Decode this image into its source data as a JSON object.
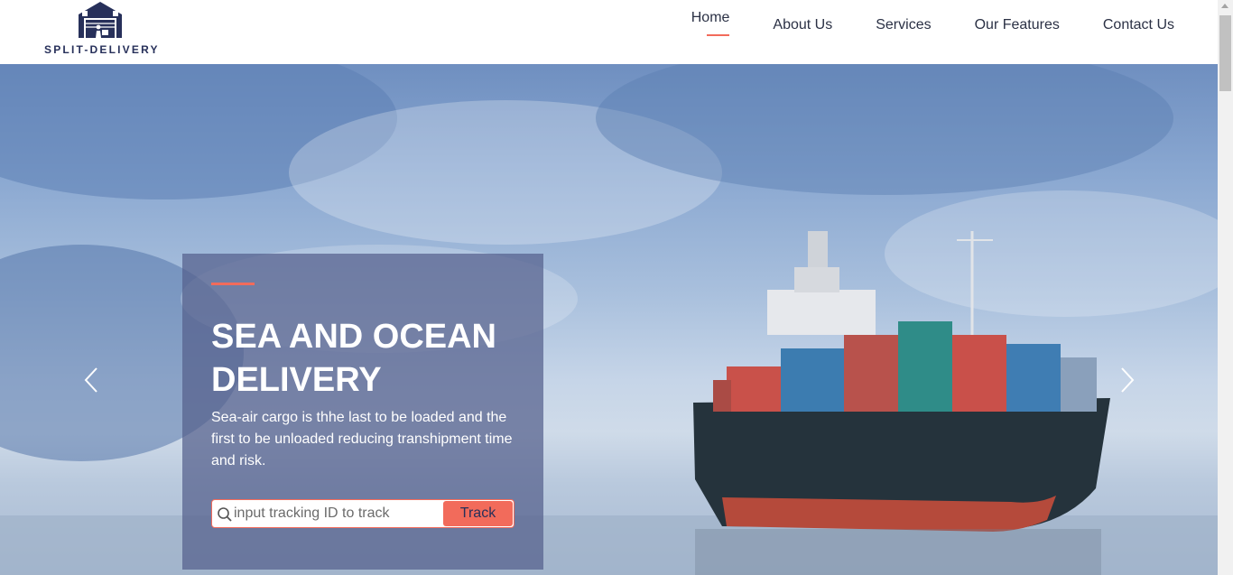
{
  "brand": {
    "name": "SPLIT-DELIVERY"
  },
  "nav": {
    "items": [
      {
        "label": "Home",
        "active": true
      },
      {
        "label": "About Us"
      },
      {
        "label": "Services"
      },
      {
        "label": "Our Features"
      },
      {
        "label": "Contact Us"
      }
    ]
  },
  "hero": {
    "title": "SEA AND OCEAN DELIVERY",
    "description": "Sea-air cargo is thhe last to be loaded and the first to be unloaded reducing transhipment time and risk.",
    "tracking": {
      "placeholder": "input tracking ID to track",
      "button_label": "Track"
    },
    "prev_icon": "chevron-left-icon",
    "next_icon": "chevron-right-icon"
  },
  "colors": {
    "accent": "#f26b5b",
    "brand": "#27305a",
    "panel": "#555f8c"
  }
}
